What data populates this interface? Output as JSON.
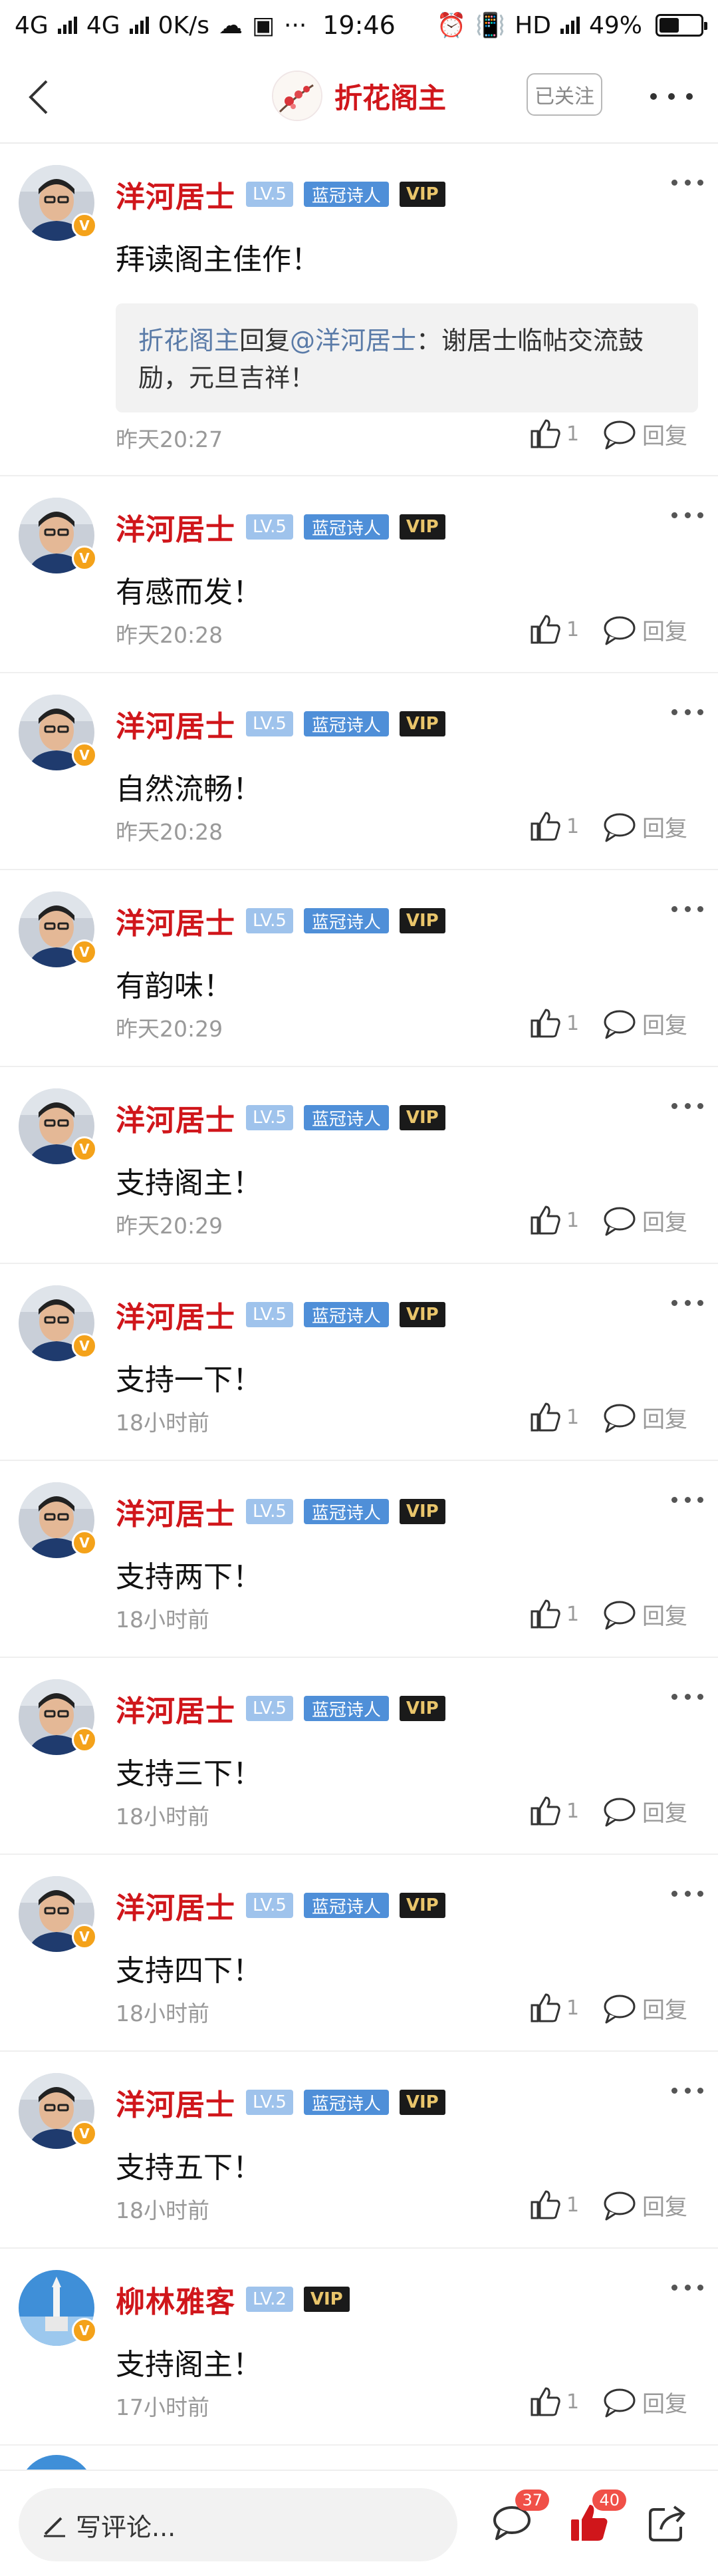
{
  "status_bar": {
    "network1": "4G",
    "network2": "4G",
    "speed": "0K/s",
    "extra": "···",
    "time": "19:46",
    "hd": "HD",
    "battery": "49%",
    "battery_level": 0.49
  },
  "header": {
    "title": "折花阁主",
    "follow_label": "已关注"
  },
  "comments": [
    {
      "name": "洋河居士",
      "level": "LV.5",
      "title_badge": "蓝冠诗人",
      "vip": "VIP",
      "text": "拜读阁主佳作！",
      "time": "昨天20:27",
      "likes": "1",
      "reply_label": "回复",
      "reply": {
        "author": "折花阁主",
        "verb": "回复",
        "target": "@洋河居士",
        "content": "：谢居士临帖交流鼓励，元旦吉祥！"
      }
    },
    {
      "name": "洋河居士",
      "level": "LV.5",
      "title_badge": "蓝冠诗人",
      "vip": "VIP",
      "text": "有感而发！",
      "time": "昨天20:28",
      "likes": "1",
      "reply_label": "回复"
    },
    {
      "name": "洋河居士",
      "level": "LV.5",
      "title_badge": "蓝冠诗人",
      "vip": "VIP",
      "text": "自然流畅！",
      "time": "昨天20:28",
      "likes": "1",
      "reply_label": "回复"
    },
    {
      "name": "洋河居士",
      "level": "LV.5",
      "title_badge": "蓝冠诗人",
      "vip": "VIP",
      "text": "有韵味！",
      "time": "昨天20:29",
      "likes": "1",
      "reply_label": "回复"
    },
    {
      "name": "洋河居士",
      "level": "LV.5",
      "title_badge": "蓝冠诗人",
      "vip": "VIP",
      "text": "支持阁主！",
      "time": "昨天20:29",
      "likes": "1",
      "reply_label": "回复"
    },
    {
      "name": "洋河居士",
      "level": "LV.5",
      "title_badge": "蓝冠诗人",
      "vip": "VIP",
      "text": "支持一下！",
      "time": "18小时前",
      "likes": "1",
      "reply_label": "回复"
    },
    {
      "name": "洋河居士",
      "level": "LV.5",
      "title_badge": "蓝冠诗人",
      "vip": "VIP",
      "text": "支持两下！",
      "time": "18小时前",
      "likes": "1",
      "reply_label": "回复"
    },
    {
      "name": "洋河居士",
      "level": "LV.5",
      "title_badge": "蓝冠诗人",
      "vip": "VIP",
      "text": "支持三下！",
      "time": "18小时前",
      "likes": "1",
      "reply_label": "回复"
    },
    {
      "name": "洋河居士",
      "level": "LV.5",
      "title_badge": "蓝冠诗人",
      "vip": "VIP",
      "text": "支持四下！",
      "time": "18小时前",
      "likes": "1",
      "reply_label": "回复"
    },
    {
      "name": "洋河居士",
      "level": "LV.5",
      "title_badge": "蓝冠诗人",
      "vip": "VIP",
      "text": "支持五下！",
      "time": "18小时前",
      "likes": "1",
      "reply_label": "回复"
    },
    {
      "name": "柳林雅客",
      "level": "LV.2",
      "title_badge": "",
      "vip": "VIP",
      "text": "支持阁主！",
      "time": "17小时前",
      "likes": "1",
      "reply_label": "回复"
    }
  ],
  "bottom_bar": {
    "input_placeholder": "写评论...",
    "comment_count": "37",
    "like_count": "40"
  },
  "colors": {
    "accent_red": "#d0161b",
    "level_badge": "#9fc3ec",
    "title_badge": "#4f8fd8",
    "vip_gold": "#e9c56b"
  }
}
